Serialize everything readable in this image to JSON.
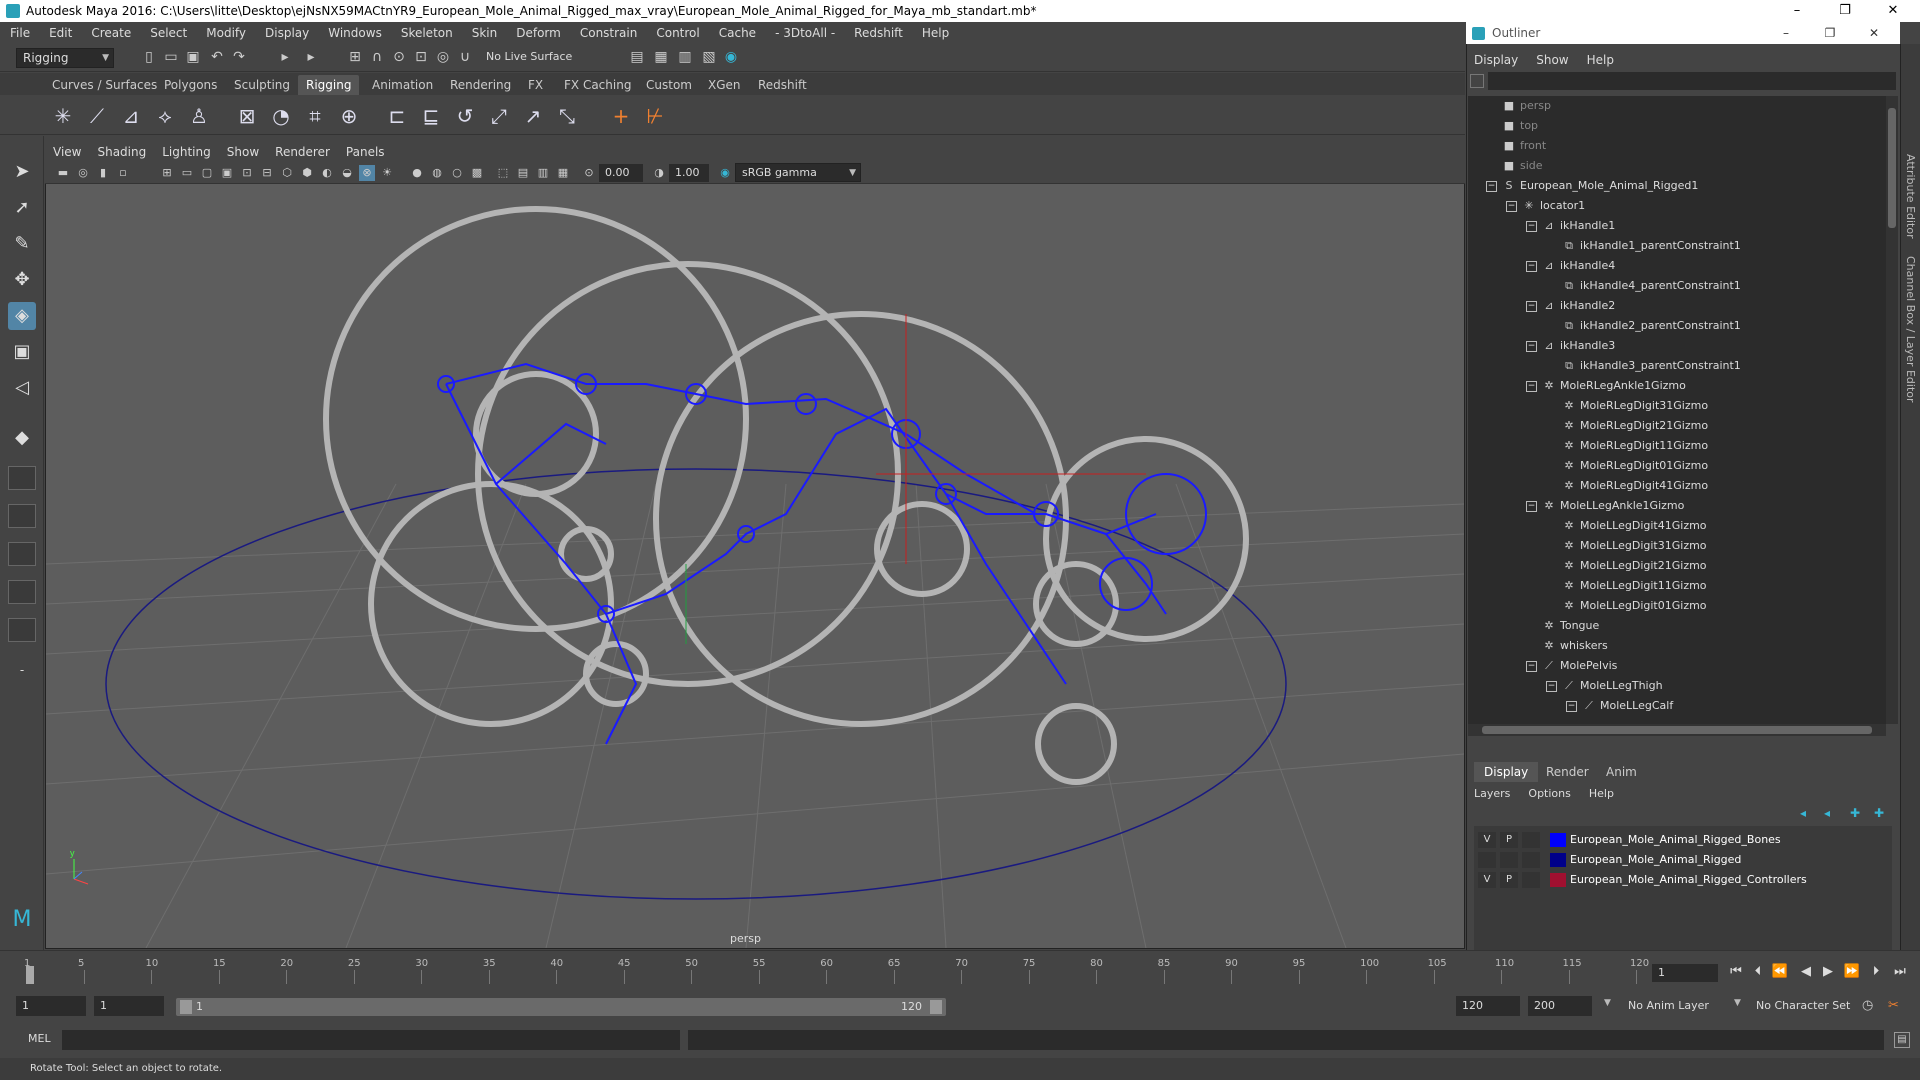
{
  "window": {
    "title": "Autodesk Maya 2016: C:\\Users\\litte\\Desktop\\ejNsNX59MACtnYR9_European_Mole_Animal_Rigged_max_vray\\European_Mole_Animal_Rigged_for_Maya_mb_standart.mb*",
    "minimize": "–",
    "restore": "❐",
    "close": "✕"
  },
  "menubar": [
    "File",
    "Edit",
    "Create",
    "Select",
    "Modify",
    "Display",
    "Windows",
    "Skeleton",
    "Skin",
    "Deform",
    "Constrain",
    "Control",
    "Cache",
    "- 3DtoAll -",
    "Redshift",
    "Help"
  ],
  "statusline": {
    "mode": "Rigging",
    "live_surface": "No Live Surface"
  },
  "shelf_tabs": [
    "Curves / Surfaces",
    "Polygons",
    "Sculpting",
    "Rigging",
    "Animation",
    "Rendering",
    "FX",
    "FX Caching",
    "Custom",
    "XGen",
    "Redshift"
  ],
  "active_shelf_tab": "Rigging",
  "viewport": {
    "menu": [
      "View",
      "Shading",
      "Lighting",
      "Show",
      "Renderer",
      "Panels"
    ],
    "exposure": "0.00",
    "gamma": "1.00",
    "colorspace": "sRGB gamma",
    "camera_label": "persp"
  },
  "outliner": {
    "title": "Outliner",
    "menu": [
      "Display",
      "Show",
      "Help"
    ],
    "items": [
      {
        "label": "persp",
        "indent": 0,
        "icon": "camera-icon",
        "dim": true,
        "exp": ""
      },
      {
        "label": "top",
        "indent": 0,
        "icon": "camera-icon",
        "dim": true,
        "exp": ""
      },
      {
        "label": "front",
        "indent": 0,
        "icon": "camera-icon",
        "dim": true,
        "exp": ""
      },
      {
        "label": "side",
        "indent": 0,
        "icon": "camera-icon",
        "dim": true,
        "exp": ""
      },
      {
        "label": "European_Mole_Animal_Rigged1",
        "indent": 0,
        "icon": "curve-icon",
        "dim": false,
        "exp": "−"
      },
      {
        "label": "locator1",
        "indent": 1,
        "icon": "locator-icon",
        "dim": false,
        "exp": "−"
      },
      {
        "label": "ikHandle1",
        "indent": 2,
        "icon": "ik-handle-icon",
        "dim": false,
        "exp": "−"
      },
      {
        "label": "ikHandle1_parentConstraint1",
        "indent": 3,
        "icon": "constraint-icon",
        "dim": false,
        "exp": ""
      },
      {
        "label": "ikHandle4",
        "indent": 2,
        "icon": "ik-handle-icon",
        "dim": false,
        "exp": "−"
      },
      {
        "label": "ikHandle4_parentConstraint1",
        "indent": 3,
        "icon": "constraint-icon",
        "dim": false,
        "exp": ""
      },
      {
        "label": "ikHandle2",
        "indent": 2,
        "icon": "ik-handle-icon",
        "dim": false,
        "exp": "−"
      },
      {
        "label": "ikHandle2_parentConstraint1",
        "indent": 3,
        "icon": "constraint-icon",
        "dim": false,
        "exp": ""
      },
      {
        "label": "ikHandle3",
        "indent": 2,
        "icon": "ik-handle-icon",
        "dim": false,
        "exp": "−"
      },
      {
        "label": "ikHandle3_parentConstraint1",
        "indent": 3,
        "icon": "constraint-icon",
        "dim": false,
        "exp": ""
      },
      {
        "label": "MoleRLegAnkle1Gizmo",
        "indent": 2,
        "icon": "gizmo-icon",
        "dim": false,
        "exp": "−"
      },
      {
        "label": "MoleRLegDigit31Gizmo",
        "indent": 3,
        "icon": "gizmo-icon",
        "dim": false,
        "exp": ""
      },
      {
        "label": "MoleRLegDigit21Gizmo",
        "indent": 3,
        "icon": "gizmo-icon",
        "dim": false,
        "exp": ""
      },
      {
        "label": "MoleRLegDigit11Gizmo",
        "indent": 3,
        "icon": "gizmo-icon",
        "dim": false,
        "exp": ""
      },
      {
        "label": "MoleRLegDigit01Gizmo",
        "indent": 3,
        "icon": "gizmo-icon",
        "dim": false,
        "exp": ""
      },
      {
        "label": "MoleRLegDigit41Gizmo",
        "indent": 3,
        "icon": "gizmo-icon",
        "dim": false,
        "exp": ""
      },
      {
        "label": "MoleLLegAnkle1Gizmo",
        "indent": 2,
        "icon": "gizmo-icon",
        "dim": false,
        "exp": "−"
      },
      {
        "label": "MoleLLegDigit41Gizmo",
        "indent": 3,
        "icon": "gizmo-icon",
        "dim": false,
        "exp": ""
      },
      {
        "label": "MoleLLegDigit31Gizmo",
        "indent": 3,
        "icon": "gizmo-icon",
        "dim": false,
        "exp": ""
      },
      {
        "label": "MoleLLegDigit21Gizmo",
        "indent": 3,
        "icon": "gizmo-icon",
        "dim": false,
        "exp": ""
      },
      {
        "label": "MoleLLegDigit11Gizmo",
        "indent": 3,
        "icon": "gizmo-icon",
        "dim": false,
        "exp": ""
      },
      {
        "label": "MoleLLegDigit01Gizmo",
        "indent": 3,
        "icon": "gizmo-icon",
        "dim": false,
        "exp": ""
      },
      {
        "label": "Tongue",
        "indent": 2,
        "icon": "gizmo-icon",
        "dim": false,
        "exp": ""
      },
      {
        "label": "whiskers",
        "indent": 2,
        "icon": "gizmo-icon",
        "dim": false,
        "exp": ""
      },
      {
        "label": "MolePelvis",
        "indent": 2,
        "icon": "joint-icon",
        "dim": false,
        "exp": "−"
      },
      {
        "label": "MoleLLegThigh",
        "indent": 3,
        "icon": "joint-icon",
        "dim": false,
        "exp": "−"
      },
      {
        "label": "MoleLLegCalf",
        "indent": 4,
        "icon": "joint-icon",
        "dim": false,
        "exp": "−"
      }
    ]
  },
  "layer_editor": {
    "tabs": [
      "Display",
      "Render",
      "Anim"
    ],
    "active_tab": "Display",
    "menu": [
      "Layers",
      "Options",
      "Help"
    ],
    "layers": [
      {
        "v": "V",
        "p": "P",
        "color": "#0000ff",
        "name": "European_Mole_Animal_Rigged_Bones"
      },
      {
        "v": "",
        "p": "",
        "color": "#00008a",
        "name": "European_Mole_Animal_Rigged"
      },
      {
        "v": "V",
        "p": "P",
        "color": "#a01030",
        "name": "European_Mole_Animal_Rigged_Controllers"
      }
    ]
  },
  "side_tabs": [
    "Attribute Editor",
    "Channel Box / Layer Editor"
  ],
  "timeline": {
    "ticks": [
      "1",
      "5",
      "10",
      "15",
      "20",
      "25",
      "30",
      "35",
      "40",
      "45",
      "50",
      "55",
      "60",
      "65",
      "70",
      "75",
      "80",
      "85",
      "90",
      "95",
      "100",
      "105",
      "110",
      "115",
      "120"
    ],
    "current_frame": "1",
    "range_start": "1",
    "playback_start": "1",
    "slider_start": "1",
    "slider_end": "120",
    "playback_end": "120",
    "range_end": "200",
    "anim_layer": "No Anim Layer",
    "character_set": "No Character Set"
  },
  "command_line": {
    "lang": "MEL"
  },
  "help_line": "Rotate Tool: Select an object to rotate.",
  "colors": {
    "bones": "#1a1aff",
    "controllers": "#b4b4b4",
    "selection": "#5285a6"
  }
}
